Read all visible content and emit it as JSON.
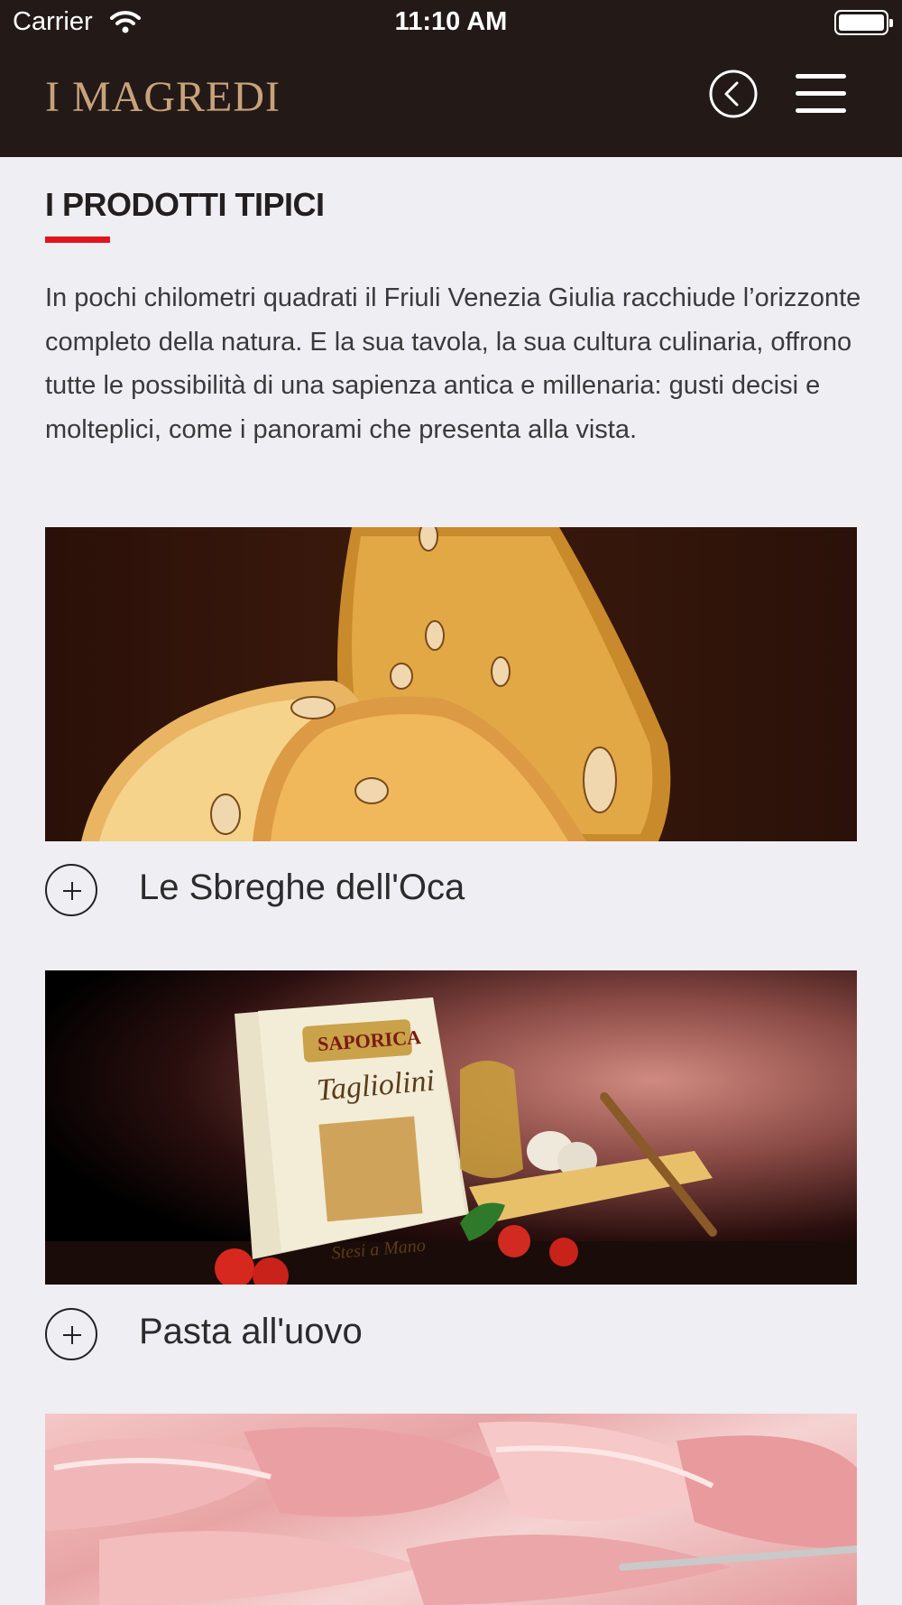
{
  "status_bar": {
    "carrier": "Carrier",
    "time": "11:10 AM"
  },
  "header": {
    "logo": "I MAGREDI",
    "back_icon": "back-circle-icon",
    "menu_icon": "hamburger-menu-icon",
    "background": "#231a18",
    "logo_color": "#c8a27a"
  },
  "section": {
    "title": "I PRODOTTI TIPICI",
    "accent": "#e0151b",
    "intro": "In pochi chilometri quadrati il Friuli Venezia Giulia racchiude l’orizzonte completo della natura. E la sua tavola, la sua cultura culinaria, offrono tutte le possibilità di una sapienza antica e millenaria: gusti decisi e molteplici, come i panorami che presenta alla vista."
  },
  "products": [
    {
      "label": "Le Sbreghe dell'Oca",
      "icon": "plus-circle-icon"
    },
    {
      "label": "Pasta all'uovo",
      "icon": "plus-circle-icon",
      "package_brand": "SAPORICA",
      "package_product": "Tagliolini",
      "package_note": "Stesi a Mano"
    },
    {
      "label": "",
      "icon": "plus-circle-icon"
    }
  ]
}
